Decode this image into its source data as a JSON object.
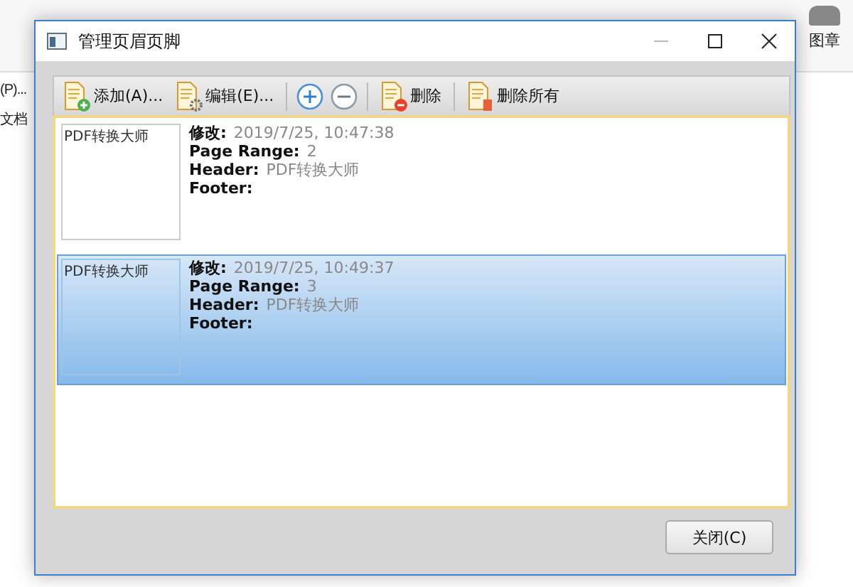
{
  "background_app": {
    "left_labels": [
      "(P)...",
      "文档"
    ],
    "right_label": "图章"
  },
  "dialog": {
    "title": "管理页眉页脚",
    "toolbar": [
      {
        "kind": "add",
        "label": "添加(A)..."
      },
      {
        "kind": "edit",
        "label": "编辑(E)..."
      },
      {
        "kind": "plus"
      },
      {
        "kind": "minus"
      },
      {
        "kind": "delete",
        "label": "删除"
      },
      {
        "kind": "delete_all",
        "label": "删除所有"
      }
    ],
    "items": [
      {
        "selected": false,
        "thumbnail_text": "PDF转换大师",
        "fields": [
          {
            "label": "修改:",
            "value": "2019/7/25, 10:47:38"
          },
          {
            "label": "Page Range:",
            "value": "2"
          },
          {
            "label": "Header:",
            "value": "PDF转换大师"
          },
          {
            "label": "Footer:"
          }
        ]
      },
      {
        "selected": true,
        "thumbnail_text": "PDF转换大师",
        "fields": [
          {
            "label": "修改:",
            "value": "2019/7/25, 10:49:37"
          },
          {
            "label": "Page Range:",
            "value": "3"
          },
          {
            "label": "Header:",
            "value": "PDF转换大师"
          },
          {
            "label": "Footer:"
          }
        ]
      }
    ],
    "close_button": "关闭(C)"
  }
}
